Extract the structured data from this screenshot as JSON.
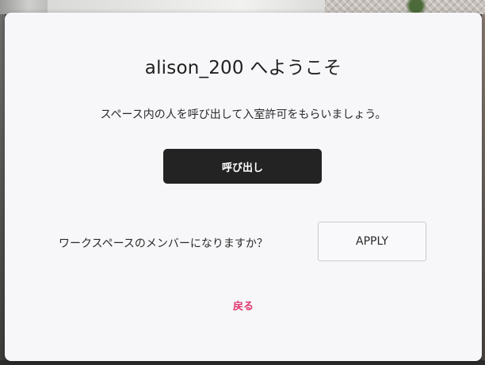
{
  "dialog": {
    "title": "alison_200 へようこそ",
    "description": "スペース内の人を呼び出して入室許可をもらいましょう。",
    "call_button_label": "呼び出し",
    "member_question": "ワークスペースのメンバーになりますか？",
    "apply_button_label": "APPLY",
    "back_link_label": "戻る"
  },
  "colors": {
    "dialog_background": "#f7f7f9",
    "primary_button": "#232323",
    "back_link": "#e0356b"
  }
}
